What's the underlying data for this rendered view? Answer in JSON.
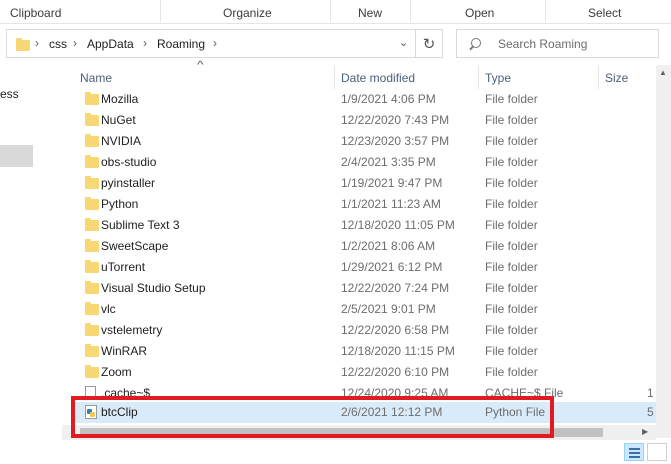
{
  "ribbon": {
    "groups": [
      "Clipboard",
      "Organize",
      "New",
      "Open",
      "Select"
    ]
  },
  "address_bar": {
    "breadcrumbs": [
      "css",
      "AppData",
      "Roaming"
    ],
    "dropdown_icon": "chevron-down-icon",
    "refresh_icon": "refresh-icon"
  },
  "search": {
    "placeholder": "Search Roaming"
  },
  "nav_pane": {
    "partial_text": "ess"
  },
  "columns": {
    "name": "Name",
    "date": "Date modified",
    "type": "Type",
    "size": "Size"
  },
  "files": [
    {
      "name": "Mozilla",
      "date": "1/9/2021 4:06 PM",
      "type": "File folder",
      "size": "",
      "icon": "folder-icon"
    },
    {
      "name": "NuGet",
      "date": "12/22/2020 7:43 PM",
      "type": "File folder",
      "size": "",
      "icon": "folder-icon"
    },
    {
      "name": "NVIDIA",
      "date": "12/23/2020 3:57 PM",
      "type": "File folder",
      "size": "",
      "icon": "folder-icon"
    },
    {
      "name": "obs-studio",
      "date": "2/4/2021 3:35 PM",
      "type": "File folder",
      "size": "",
      "icon": "folder-icon"
    },
    {
      "name": "pyinstaller",
      "date": "1/19/2021 9:47 PM",
      "type": "File folder",
      "size": "",
      "icon": "folder-icon"
    },
    {
      "name": "Python",
      "date": "1/1/2021 11:23 AM",
      "type": "File folder",
      "size": "",
      "icon": "folder-icon"
    },
    {
      "name": "Sublime Text 3",
      "date": "12/18/2020 11:05 PM",
      "type": "File folder",
      "size": "",
      "icon": "folder-icon"
    },
    {
      "name": "SweetScape",
      "date": "1/2/2021 8:06 AM",
      "type": "File folder",
      "size": "",
      "icon": "folder-icon"
    },
    {
      "name": "uTorrent",
      "date": "1/29/2021 6:12 PM",
      "type": "File folder",
      "size": "",
      "icon": "folder-icon"
    },
    {
      "name": "Visual Studio Setup",
      "date": "12/22/2020 7:24 PM",
      "type": "File folder",
      "size": "",
      "icon": "folder-icon"
    },
    {
      "name": "vlc",
      "date": "2/5/2021 9:01 PM",
      "type": "File folder",
      "size": "",
      "icon": "folder-icon"
    },
    {
      "name": "vstelemetry",
      "date": "12/22/2020 6:58 PM",
      "type": "File folder",
      "size": "",
      "icon": "folder-icon"
    },
    {
      "name": "WinRAR",
      "date": "12/18/2020 11:15 PM",
      "type": "File folder",
      "size": "",
      "icon": "folder-icon"
    },
    {
      "name": "Zoom",
      "date": "12/22/2020 6:10 PM",
      "type": "File folder",
      "size": "",
      "icon": "folder-icon"
    },
    {
      "name": ".cache~$",
      "date": "12/24/2020 9:25 AM",
      "type": "CACHE~$ File",
      "size": "1",
      "icon": "file-icon"
    },
    {
      "name": "btcClip",
      "date": "2/6/2021 12:12 PM",
      "type": "Python File",
      "size": "5",
      "icon": "python-file-icon"
    }
  ],
  "selected_file": "btcClip",
  "highlight_color": "#e21b23",
  "selection_color": "#d9ebf9",
  "folder_color": "#f8d775"
}
